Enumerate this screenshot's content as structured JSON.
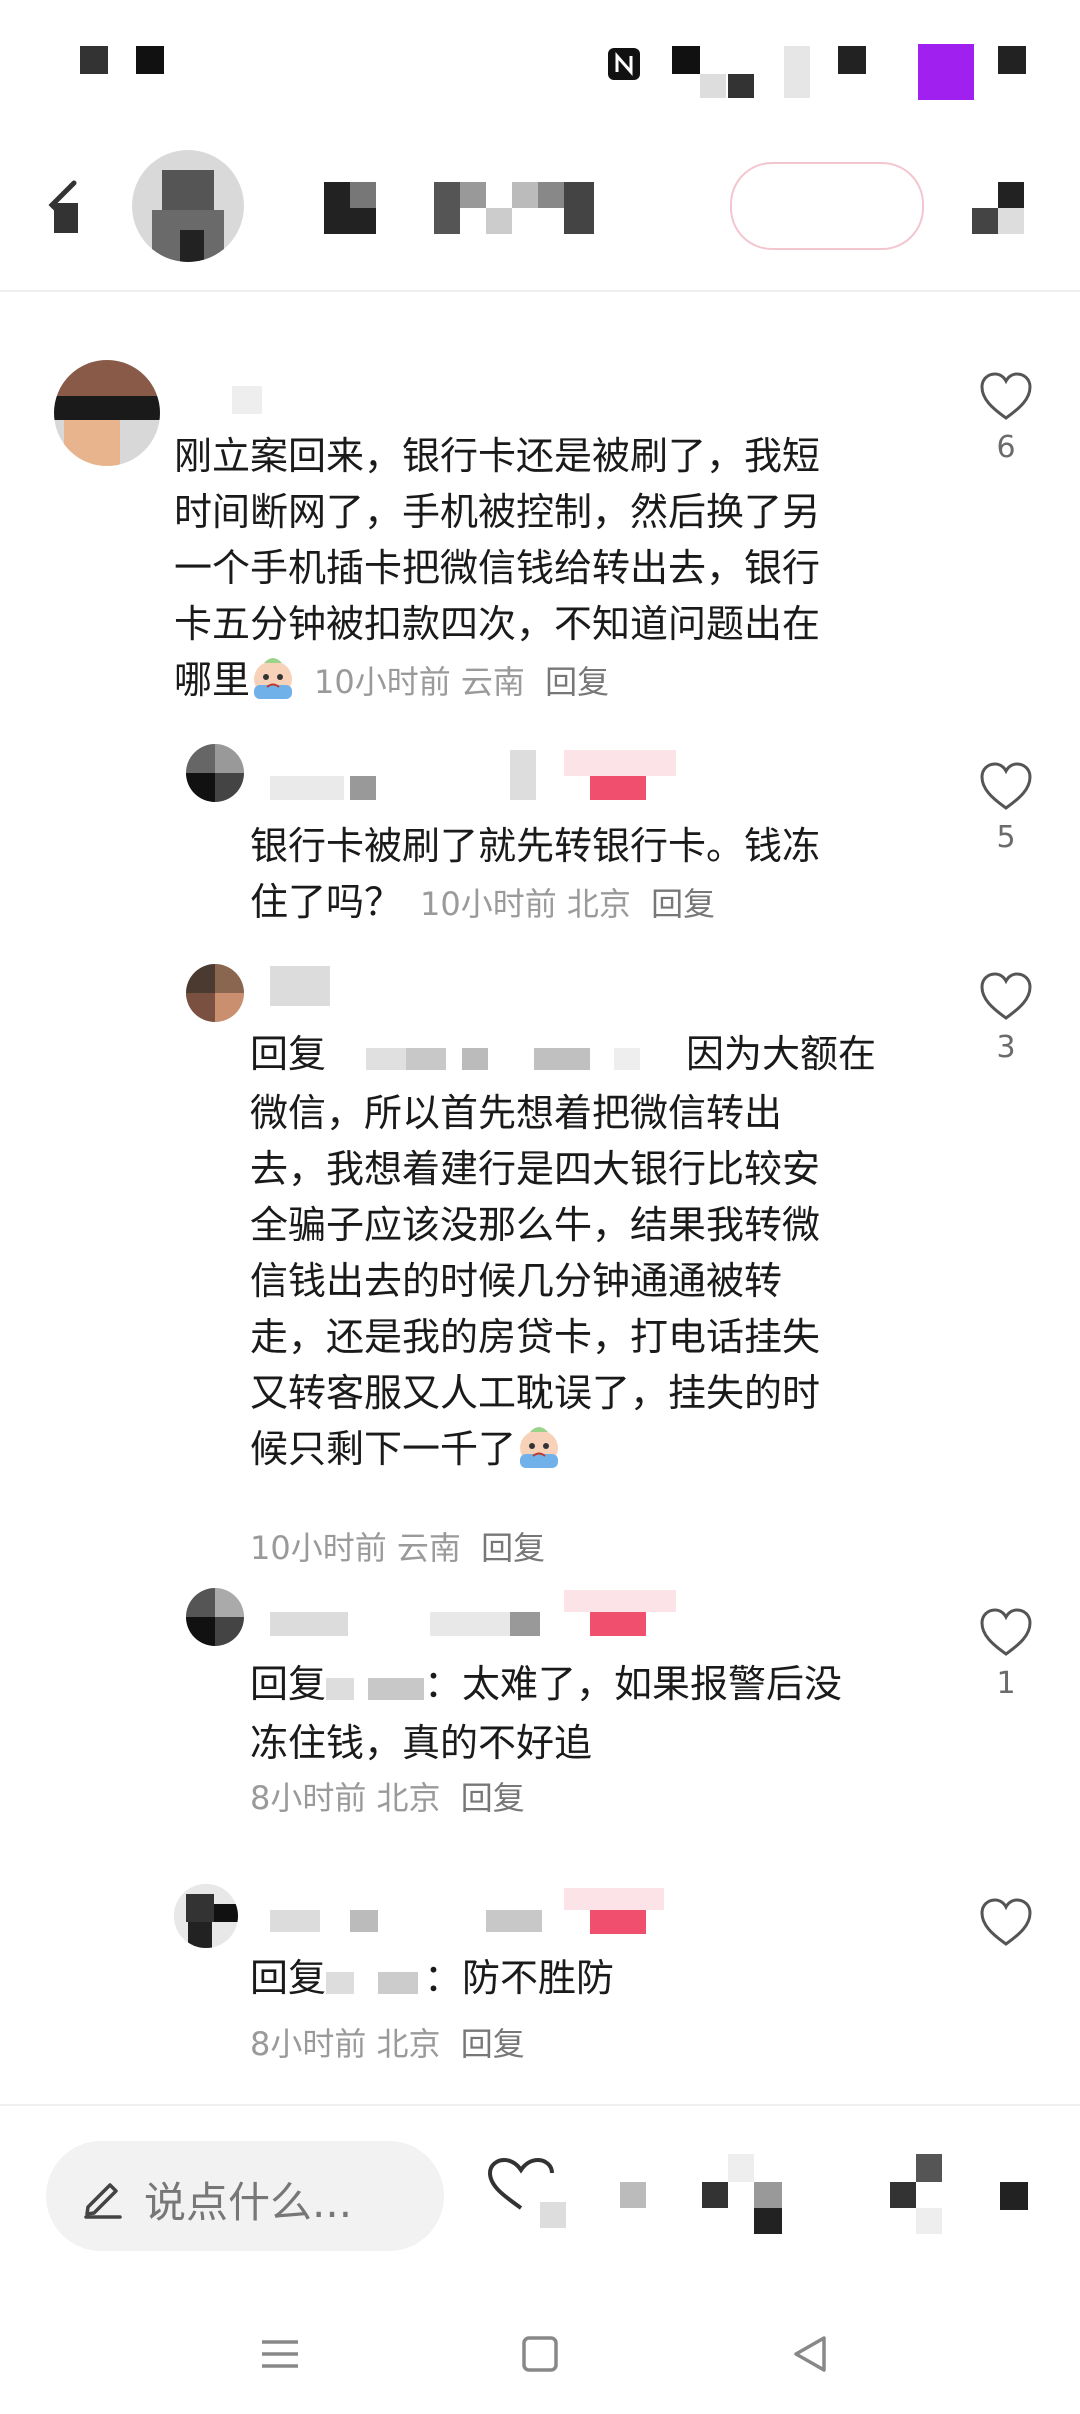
{
  "comments": [
    {
      "text": "刚立案回来，银行卡还是被刷了，我短\n时间断网了，手机被控制，然后换了另\n一个手机插卡把微信钱给转出去，银行\n卡五分钟被扣款四次，不知道问题出在\n哪里",
      "time": "10小时前",
      "location": "云南",
      "reply": "回复",
      "likes": "6"
    },
    {
      "text": "银行卡被刷了就先转银行卡。钱冻\n住了吗？",
      "time": "10小时前",
      "location": "北京",
      "reply": "回复",
      "likes": "5"
    },
    {
      "prefix": "回复",
      "text_line1": "因为大额在",
      "text_rest": "微信，所以首先想着把微信转出\n去，我想着建行是四大银行比较安\n全骗子应该没那么牛，结果我转微\n信钱出去的时候几分钟通通被转\n走，还是我的房贷卡，打电话挂失\n又转客服又人工耽误了，挂失的时\n候只剩下一千了",
      "time": "10小时前",
      "location": "云南",
      "reply": "回复",
      "likes": "3"
    },
    {
      "prefix": "回复",
      "text_line1": "：太难了，如果报警后没",
      "text_line2": "冻住钱，真的不好追",
      "time": "8小时前",
      "location": "北京",
      "reply": "回复",
      "likes": "1"
    },
    {
      "prefix": "回复",
      "text_line1": "：防不胜防",
      "time": "8小时前",
      "location": "北京",
      "reply": "回复",
      "likes": ""
    }
  ],
  "bottom": {
    "placeholder": "说点什么..."
  },
  "colors": {
    "accent_pink": "#f0506e",
    "purple_block": "#a020f0"
  },
  "icons": [
    "back-icon",
    "heart-icon",
    "pen-icon",
    "menu-icon",
    "home-icon",
    "back-triangle-icon",
    "emoji-icon",
    "nfc-icon"
  ]
}
